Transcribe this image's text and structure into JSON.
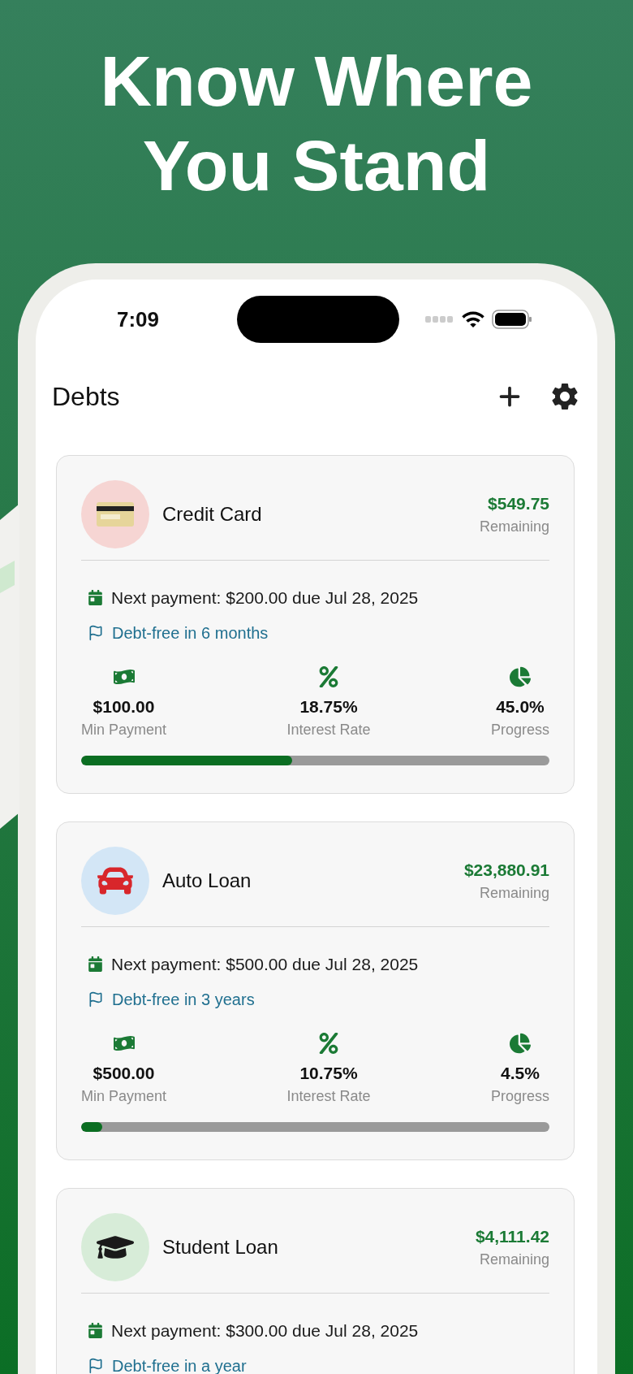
{
  "headline": [
    "Know Where",
    "You Stand"
  ],
  "status_bar": {
    "time": "7:09"
  },
  "header": {
    "title": "Debts"
  },
  "debts": [
    {
      "name": "Credit Card",
      "color": "#f6d5d3",
      "amount": "$549.75",
      "amount_label": "Remaining",
      "next_payment": "Next payment: $200.00 due Jul 28, 2025",
      "debt_free": "Debt-free in 6 months",
      "stats": [
        {
          "value": "$100.00",
          "label": "Min Payment"
        },
        {
          "value": "18.75%",
          "label": "Interest Rate"
        },
        {
          "value": "45.0%",
          "label": "Progress"
        }
      ],
      "level": 0.45
    },
    {
      "name": "Auto Loan",
      "color": "#d3e6f6",
      "amount": "$23,880.91",
      "amount_label": "Remaining",
      "next_payment": "Next payment: $500.00 due Jul 28, 2025",
      "debt_free": "Debt-free in 3 years",
      "stats": [
        {
          "value": "$500.00",
          "label": "Min Payment"
        },
        {
          "value": "10.75%",
          "label": "Interest Rate"
        },
        {
          "value": "4.5%",
          "label": "Progress"
        }
      ],
      "level": 0.045
    },
    {
      "name": "Student Loan",
      "color": "#d7ecd8",
      "amount": "$4,111.42",
      "amount_label": "Remaining",
      "next_payment": "Next payment: $300.00 due Jul 28, 2025",
      "debt_free": "Debt-free in a year"
    }
  ]
}
